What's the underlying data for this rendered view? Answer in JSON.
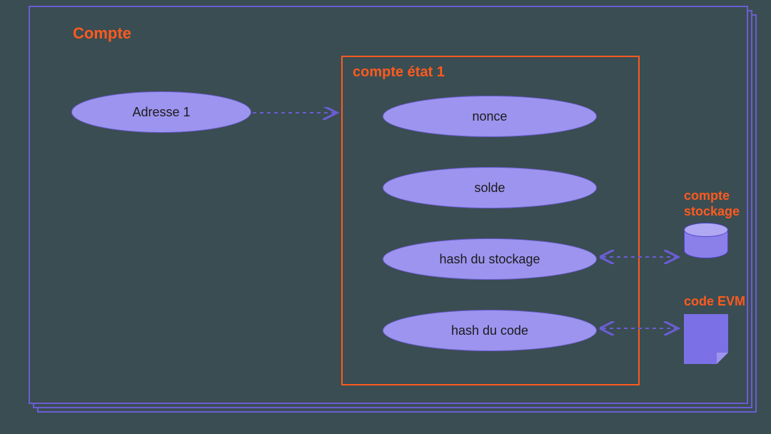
{
  "outer": {
    "title": "Compte"
  },
  "address": {
    "label": "Adresse 1"
  },
  "state": {
    "title": "compte état 1",
    "fields": [
      {
        "label": "nonce"
      },
      {
        "label": "solde"
      },
      {
        "label": "hash du stockage"
      },
      {
        "label": "hash du code"
      }
    ]
  },
  "storage": {
    "label": "compte\nstockage"
  },
  "code": {
    "label": "code EVM"
  }
}
